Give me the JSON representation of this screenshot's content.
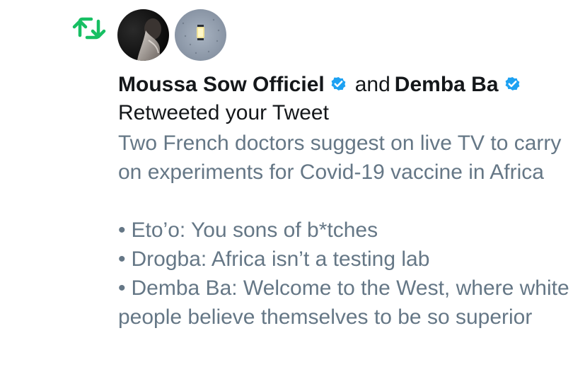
{
  "notification": {
    "type_icon": "retweet-icon",
    "accent_color": "#17bf63",
    "verified_color": "#1da1f2",
    "users": [
      {
        "name": "Moussa Sow Officiel",
        "verified": true,
        "avatar": "portrait-avatar"
      },
      {
        "name": "Demba Ba",
        "verified": true,
        "avatar": "lantern-avatar"
      }
    ],
    "conjunction": "and",
    "action": "Retweeted your Tweet",
    "tweet": {
      "intro": "Two French doctors suggest on live TV to carry on experiments for Covid-19 vaccine in Africa",
      "bullets": [
        "Eto’o: You sons of b*tches",
        "Drogba: Africa isn’t a testing lab",
        "Demba Ba: Welcome to the West, where white people believe themselves to be so superior"
      ],
      "bullet_char": "•"
    }
  }
}
